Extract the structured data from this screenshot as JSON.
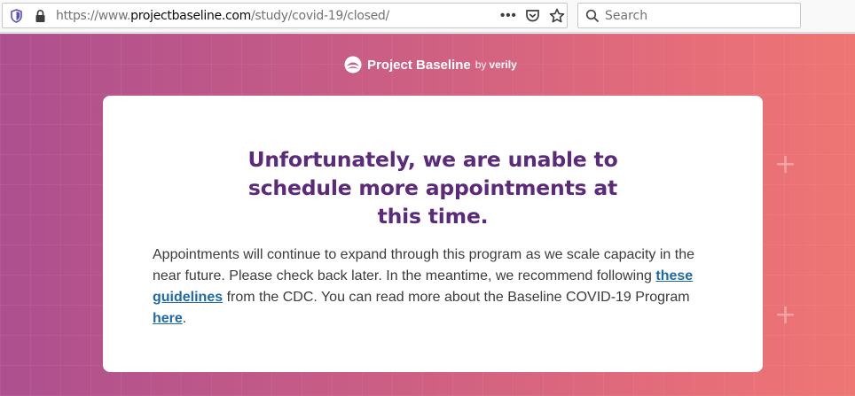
{
  "browser": {
    "url_prefix": "https://www.",
    "url_host": "projectbaseline.com",
    "url_path": "/study/covid-19/closed/",
    "page_actions_label": "•••",
    "search_placeholder": "Search"
  },
  "header": {
    "brand_name": "Project Baseline",
    "brand_by": "by",
    "brand_parent": "verily"
  },
  "card": {
    "headline": "Unfortunately, we are unable to schedule more appointments at this time.",
    "body_part1": "Appointments will continue to expand through this program as we scale capacity in the near future.  Please check back later. In the meantime, we recommend following ",
    "link_guidelines": "these guidelines",
    "body_part2": " from the CDC. You can read more about the Baseline COVID-19 Program ",
    "link_here": "here",
    "body_part3": "."
  },
  "colors": {
    "headline": "#5b2a7a",
    "link": "#1f6aa5",
    "gradient_start": "#ad4f8f",
    "gradient_end": "#ee7673"
  }
}
